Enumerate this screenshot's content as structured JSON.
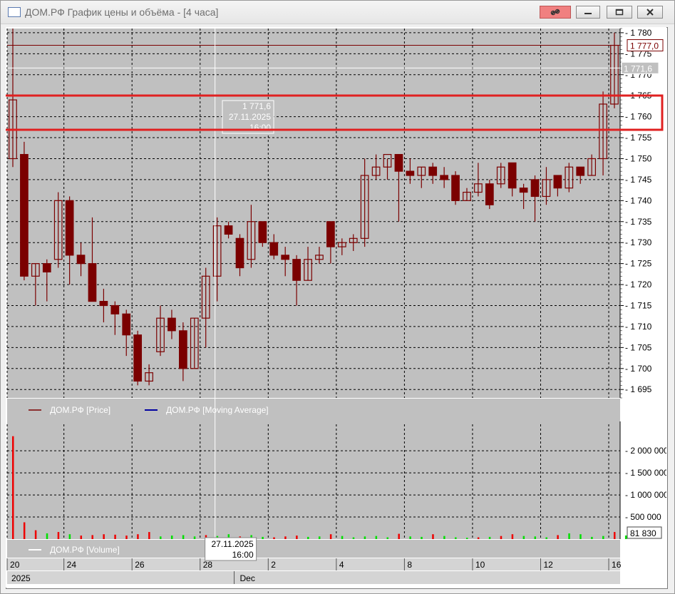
{
  "window": {
    "title": "ДОМ.РФ График цены и объёма - [4 часа]"
  },
  "colors": {
    "panel_bg": "#c0c0c0",
    "candle": "#7b0000",
    "volume_up": "#00e000",
    "volume_down": "#ee0000",
    "grid": "#000000",
    "highlight": "#e02020",
    "ma_legend": "#0000a0"
  },
  "chart_data": {
    "type": "candlestick",
    "price_axis": {
      "ticks": [
        "1 780",
        "1 775",
        "1 770",
        "1 765",
        "1 760",
        "1 755",
        "1 750",
        "1 745",
        "1 740",
        "1 735",
        "1 730",
        "1 725",
        "1 720",
        "1 715",
        "1 710",
        "1 705",
        "1 700",
        "1 695"
      ],
      "ylim": [
        1693,
        1781
      ],
      "last_price_label": "1 777,0",
      "cursor_price_label": "1 771,6"
    },
    "volume_axis": {
      "ticks": [
        "2 000 000",
        "1 500 000",
        "1 000 000",
        "500 000"
      ],
      "ylim": [
        0,
        2600000
      ],
      "last_volume_label": "81 830"
    },
    "cursor": {
      "price": "1 771,6",
      "date": "27.11.2025",
      "time": "16:00"
    },
    "legend": {
      "price": "ДОМ.РФ [Price]",
      "moving_average": "ДОМ.РФ [Moving Average]",
      "volume": "ДОМ.РФ [Volume]"
    },
    "x_axis": {
      "day_labels": [
        "20",
        "24",
        "26",
        "28",
        "2",
        "4",
        "8",
        "10",
        "12",
        "16"
      ],
      "day_label_candle_index": [
        0,
        5,
        11,
        17,
        23,
        29,
        35,
        41,
        47,
        53
      ],
      "period_labels": [
        "2025",
        "Dec"
      ],
      "period_label_candle_index": [
        0,
        20
      ]
    },
    "candles": [
      {
        "o": 1750,
        "h": 1781,
        "l": 1748,
        "c": 1764
      },
      {
        "o": 1751,
        "h": 1754,
        "l": 1721,
        "c": 1722
      },
      {
        "o": 1722,
        "h": 1725,
        "l": 1715,
        "c": 1725
      },
      {
        "o": 1725,
        "h": 1726,
        "l": 1716,
        "c": 1723
      },
      {
        "o": 1726,
        "h": 1742,
        "l": 1724,
        "c": 1740
      },
      {
        "o": 1740,
        "h": 1741,
        "l": 1720,
        "c": 1727
      },
      {
        "o": 1727,
        "h": 1730,
        "l": 1722,
        "c": 1725
      },
      {
        "o": 1725,
        "h": 1736,
        "l": 1716,
        "c": 1716
      },
      {
        "o": 1716,
        "h": 1719,
        "l": 1711,
        "c": 1715
      },
      {
        "o": 1715,
        "h": 1716,
        "l": 1708,
        "c": 1713
      },
      {
        "o": 1713,
        "h": 1714,
        "l": 1703,
        "c": 1708
      },
      {
        "o": 1708,
        "h": 1709,
        "l": 1696,
        "c": 1697
      },
      {
        "o": 1697,
        "h": 1701,
        "l": 1696,
        "c": 1699
      },
      {
        "o": 1704,
        "h": 1715,
        "l": 1703,
        "c": 1712
      },
      {
        "o": 1712,
        "h": 1714,
        "l": 1707,
        "c": 1709
      },
      {
        "o": 1709,
        "h": 1711,
        "l": 1697,
        "c": 1700
      },
      {
        "o": 1700,
        "h": 1712,
        "l": 1700,
        "c": 1712
      },
      {
        "o": 1712,
        "h": 1724,
        "l": 1705,
        "c": 1722
      },
      {
        "o": 1722,
        "h": 1736,
        "l": 1716,
        "c": 1734
      },
      {
        "o": 1734,
        "h": 1735,
        "l": 1731,
        "c": 1732
      },
      {
        "o": 1731,
        "h": 1732,
        "l": 1722,
        "c": 1724
      },
      {
        "o": 1726,
        "h": 1739,
        "l": 1724,
        "c": 1735
      },
      {
        "o": 1735,
        "h": 1735,
        "l": 1729,
        "c": 1730
      },
      {
        "o": 1730,
        "h": 1732,
        "l": 1726,
        "c": 1727
      },
      {
        "o": 1727,
        "h": 1729,
        "l": 1722,
        "c": 1726
      },
      {
        "o": 1726,
        "h": 1727,
        "l": 1715,
        "c": 1721
      },
      {
        "o": 1721,
        "h": 1729,
        "l": 1721,
        "c": 1726
      },
      {
        "o": 1726,
        "h": 1729,
        "l": 1725,
        "c": 1727
      },
      {
        "o": 1735,
        "h": 1735,
        "l": 1725,
        "c": 1729
      },
      {
        "o": 1729,
        "h": 1731,
        "l": 1727,
        "c": 1730
      },
      {
        "o": 1730,
        "h": 1732,
        "l": 1728,
        "c": 1731
      },
      {
        "o": 1731,
        "h": 1750,
        "l": 1729,
        "c": 1746
      },
      {
        "o": 1746,
        "h": 1751,
        "l": 1745,
        "c": 1748
      },
      {
        "o": 1748,
        "h": 1750,
        "l": 1745,
        "c": 1751
      },
      {
        "o": 1751,
        "h": 1751,
        "l": 1735,
        "c": 1747
      },
      {
        "o": 1747,
        "h": 1750,
        "l": 1744,
        "c": 1746
      },
      {
        "o": 1746,
        "h": 1748,
        "l": 1743,
        "c": 1748
      },
      {
        "o": 1748,
        "h": 1749,
        "l": 1744,
        "c": 1746
      },
      {
        "o": 1746,
        "h": 1748,
        "l": 1743,
        "c": 1745
      },
      {
        "o": 1746,
        "h": 1747,
        "l": 1739,
        "c": 1740
      },
      {
        "o": 1740,
        "h": 1743,
        "l": 1740,
        "c": 1742
      },
      {
        "o": 1742,
        "h": 1749,
        "l": 1741,
        "c": 1744
      },
      {
        "o": 1744,
        "h": 1745,
        "l": 1738,
        "c": 1739
      },
      {
        "o": 1744,
        "h": 1749,
        "l": 1743,
        "c": 1748
      },
      {
        "o": 1749,
        "h": 1749,
        "l": 1741,
        "c": 1743
      },
      {
        "o": 1743,
        "h": 1744,
        "l": 1738,
        "c": 1742
      },
      {
        "o": 1745,
        "h": 1746,
        "l": 1735,
        "c": 1741
      },
      {
        "o": 1741,
        "h": 1748,
        "l": 1739,
        "c": 1745
      },
      {
        "o": 1746,
        "h": 1746,
        "l": 1741,
        "c": 1743
      },
      {
        "o": 1743,
        "h": 1749,
        "l": 1742,
        "c": 1748
      },
      {
        "o": 1748,
        "h": 1748,
        "l": 1744,
        "c": 1746
      },
      {
        "o": 1746,
        "h": 1751,
        "l": 1746,
        "c": 1750
      },
      {
        "o": 1750,
        "h": 1766,
        "l": 1746,
        "c": 1763
      },
      {
        "o": 1763,
        "h": 1780,
        "l": 1762,
        "c": 1777
      }
    ],
    "volumes": [
      2330000,
      380000,
      200000,
      130000,
      160000,
      110000,
      80000,
      90000,
      110000,
      100000,
      80000,
      110000,
      160000,
      60000,
      80000,
      90000,
      60000,
      90000,
      70000,
      110000,
      60000,
      90000,
      50000,
      40000,
      60000,
      80000,
      50000,
      60000,
      110000,
      70000,
      40000,
      60000,
      70000,
      40000,
      120000,
      60000,
      50000,
      110000,
      70000,
      40000,
      30000,
      40000,
      50000,
      70000,
      110000,
      70000,
      60000,
      40000,
      90000,
      130000,
      110000,
      50000,
      70000,
      160000,
      81830
    ],
    "volume_colors": [
      "down",
      "down",
      "down",
      "up",
      "down",
      "up",
      "down",
      "down",
      "down",
      "down",
      "down",
      "down",
      "down",
      "up",
      "up",
      "up",
      "up",
      "down",
      "up",
      "up",
      "down",
      "up",
      "up",
      "down",
      "down",
      "down",
      "up",
      "up",
      "down",
      "up",
      "up",
      "up",
      "up",
      "up",
      "down",
      "up",
      "up",
      "down",
      "up",
      "up",
      "up",
      "down",
      "up",
      "down",
      "down",
      "up",
      "up",
      "up",
      "down",
      "up",
      "up",
      "up",
      "up",
      "down",
      "up"
    ]
  }
}
